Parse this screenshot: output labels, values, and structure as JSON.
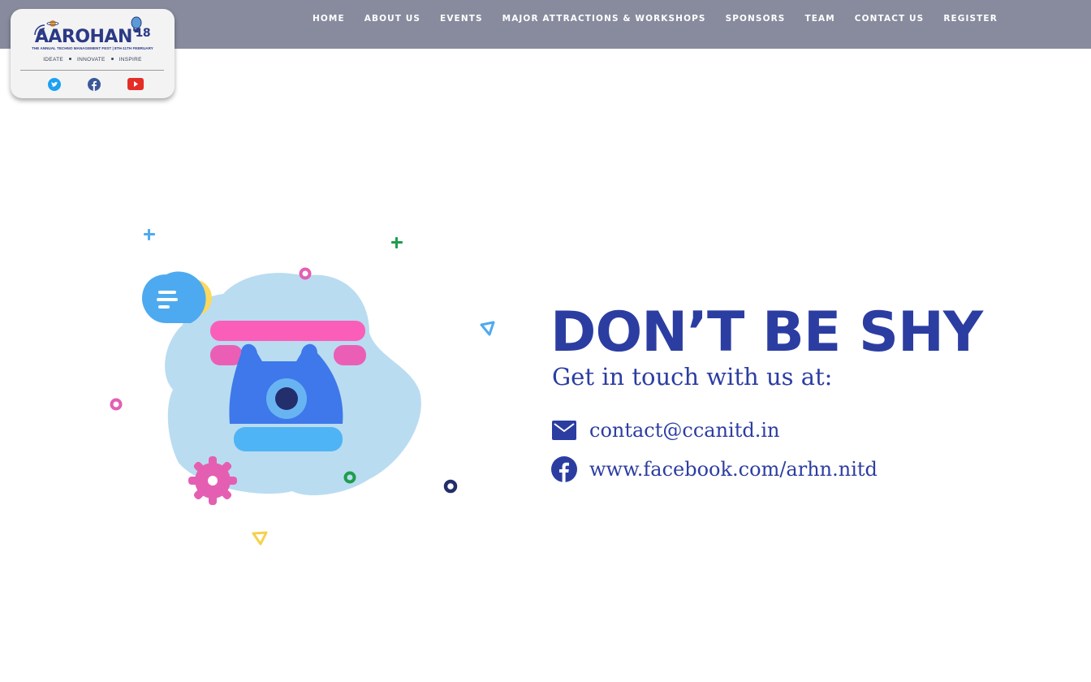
{
  "nav": {
    "items": [
      {
        "label": "HOME"
      },
      {
        "label": "ABOUT US"
      },
      {
        "label": "EVENTS"
      },
      {
        "label": "MAJOR ATTRACTIONS & WORKSHOPS"
      },
      {
        "label": "SPONSORS"
      },
      {
        "label": "TEAM"
      },
      {
        "label": "CONTACT US"
      },
      {
        "label": "REGISTER"
      }
    ]
  },
  "logo": {
    "title": "AAROHAN",
    "year": "'18",
    "subtitle": "THE ANNUAL TECHNO MANAGEMENT FEST | 8TH-11TH FEBRUARY",
    "tagline": [
      "IDEATE",
      "INNOVATE",
      "INSPIRE"
    ],
    "social_icons": [
      "twitter-icon",
      "facebook-icon",
      "youtube-icon"
    ]
  },
  "contact": {
    "headline": "DON’T BE SHY",
    "subhead": "Get in touch with us at:",
    "email": "contact@ccanitd.in",
    "facebook": "www.facebook.com/arhn.nitd",
    "icons": [
      "mail-icon",
      "facebook-icon"
    ]
  },
  "colors": {
    "topbar": "#878b9d",
    "accent": "#2c3da2",
    "logo_blue": "#2b3a86"
  }
}
